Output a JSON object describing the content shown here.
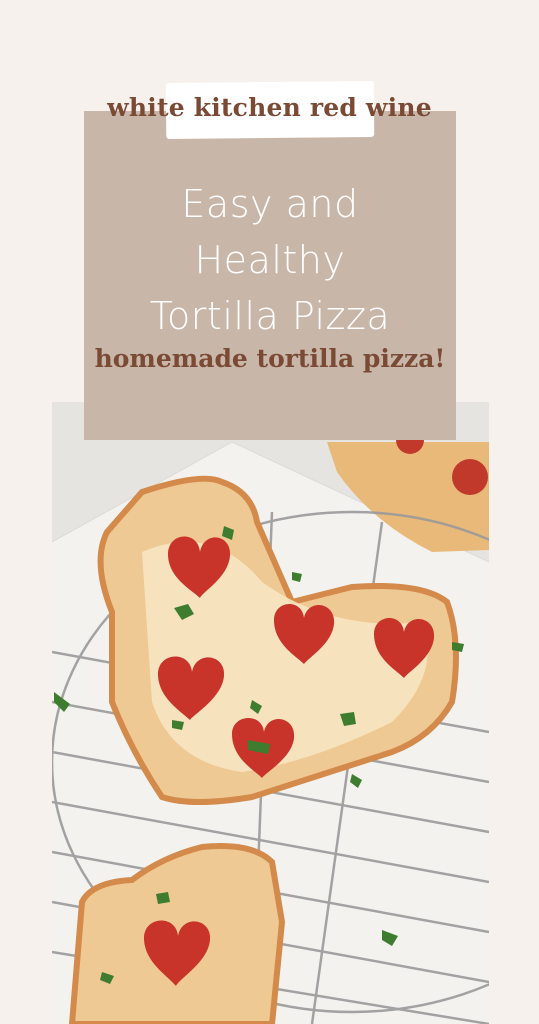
{
  "brand": {
    "name": "white kitchen red wine"
  },
  "title": {
    "lines": [
      "Easy and",
      "Healthy",
      "Tortilla Pizza"
    ]
  },
  "subtitle": {
    "text": "homemade tortilla pizza!"
  },
  "photo": {
    "subject": "heart-shaped tortilla pizzas with pepperoni hearts on a cooling rack"
  },
  "colors": {
    "background": "#f6f1ec",
    "card": "#c8b6a9",
    "brand_text": "#7a4a35",
    "title_text": "#ffffff"
  }
}
